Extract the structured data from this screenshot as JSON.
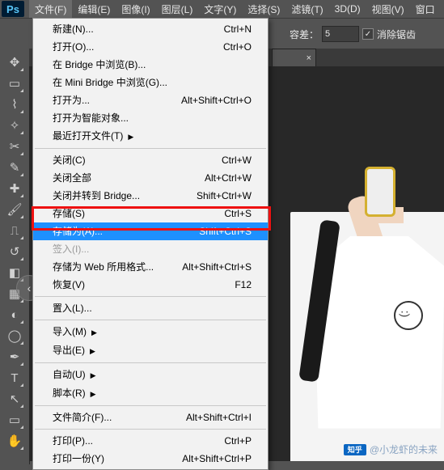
{
  "menubar": {
    "items": [
      "文件(F)",
      "编辑(E)",
      "图像(I)",
      "图层(L)",
      "文字(Y)",
      "选择(S)",
      "滤镜(T)",
      "3D(D)",
      "视图(V)",
      "窗口"
    ]
  },
  "options": {
    "tolerance_label": "容差：",
    "tolerance_value": "5",
    "antialias_label": "消除锯齿"
  },
  "doc_tab": {
    "close": "×"
  },
  "menu": {
    "items": [
      {
        "label": "新建(N)...",
        "shortcut": "Ctrl+N"
      },
      {
        "label": "打开(O)...",
        "shortcut": "Ctrl+O"
      },
      {
        "label": "在 Bridge 中浏览(B)...",
        "shortcut": ""
      },
      {
        "label": "在 Mini Bridge 中浏览(G)...",
        "shortcut": ""
      },
      {
        "label": "打开为...",
        "shortcut": "Alt+Shift+Ctrl+O"
      },
      {
        "label": "打开为智能对象...",
        "shortcut": ""
      },
      {
        "label": "最近打开文件(T)",
        "shortcut": "",
        "arrow": true
      },
      {
        "sep": true
      },
      {
        "label": "关闭(C)",
        "shortcut": "Ctrl+W"
      },
      {
        "label": "关闭全部",
        "shortcut": "Alt+Ctrl+W"
      },
      {
        "label": "关闭并转到 Bridge...",
        "shortcut": "Shift+Ctrl+W"
      },
      {
        "label": "存储(S)",
        "shortcut": "Ctrl+S"
      },
      {
        "label": "存储为(A)...",
        "shortcut": "Shift+Ctrl+S",
        "highlight": true
      },
      {
        "label": "签入(I)...",
        "shortcut": "",
        "disabled": true
      },
      {
        "label": "存储为 Web 所用格式...",
        "shortcut": "Alt+Shift+Ctrl+S"
      },
      {
        "label": "恢复(V)",
        "shortcut": "F12"
      },
      {
        "sep": true
      },
      {
        "label": "置入(L)...",
        "shortcut": ""
      },
      {
        "sep": true
      },
      {
        "label": "导入(M)",
        "shortcut": "",
        "arrow": true
      },
      {
        "label": "导出(E)",
        "shortcut": "",
        "arrow": true
      },
      {
        "sep": true
      },
      {
        "label": "自动(U)",
        "shortcut": "",
        "arrow": true
      },
      {
        "label": "脚本(R)",
        "shortcut": "",
        "arrow": true
      },
      {
        "sep": true
      },
      {
        "label": "文件简介(F)...",
        "shortcut": "Alt+Shift+Ctrl+I"
      },
      {
        "sep": true
      },
      {
        "label": "打印(P)...",
        "shortcut": "Ctrl+P"
      },
      {
        "label": "打印一份(Y)",
        "shortcut": "Alt+Shift+Ctrl+P"
      }
    ]
  },
  "watermark": {
    "logo": "知乎",
    "text": "@小龙虾的未来"
  },
  "ps_logo": "Ps",
  "round_btn": "‹"
}
